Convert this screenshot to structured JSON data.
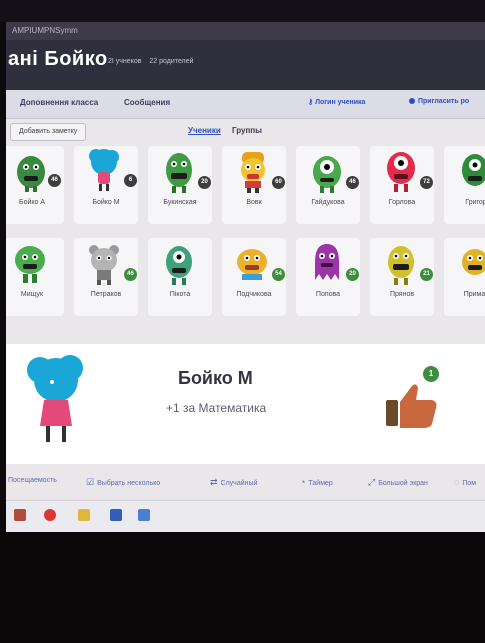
{
  "browser": {
    "tab_title": "AMPIUMPNSymm"
  },
  "header": {
    "class_title": "ані Бойко",
    "students_count": "2I учнеков",
    "parents_count": "22 родителей"
  },
  "subnav": {
    "report_label": "Доповнення класса",
    "messages_label": "Сообщения",
    "student_login_label": "Логин ученика",
    "invite_label": "Пригласить ро"
  },
  "toolbar": {
    "add_note_label": "Добавить заметку",
    "tab_students": "Ученики",
    "tab_groups": "Группы"
  },
  "students_row1": [
    {
      "name": "Бойко А",
      "points": "46",
      "color": "#3a8a3e"
    },
    {
      "name": "Бойко М",
      "points": "6",
      "color": "#1aa7d8"
    },
    {
      "name": "Букинская",
      "points": "20",
      "color": "#3f9c42"
    },
    {
      "name": "Вовк",
      "points": "60",
      "color": "#e6a21a"
    },
    {
      "name": "Гайдукова",
      "points": "46",
      "color": "#49a84a"
    },
    {
      "name": "Горлова",
      "points": "72",
      "color": "#e32c4c"
    },
    {
      "name": "Григор",
      "points": "",
      "color": "#2f8a3a"
    }
  ],
  "students_row2": [
    {
      "name": "Мищук",
      "points": "",
      "color": "#49ad4e"
    },
    {
      "name": "Петраков",
      "points": "46",
      "color": "#8a8a8a"
    },
    {
      "name": "Пікота",
      "points": "",
      "color": "#3da27b"
    },
    {
      "name": "Подчикова",
      "points": "54",
      "color": "#ebb12a"
    },
    {
      "name": "Попова",
      "points": "20",
      "color": "#9b34a6"
    },
    {
      "name": "Прянов",
      "points": "21",
      "color": "#d1c02a"
    },
    {
      "name": "Примак",
      "points": "",
      "color": "#e0b228"
    }
  ],
  "detail": {
    "student_name": "Бойко М",
    "reason": "+1 за Математика",
    "point_badge": "1"
  },
  "actions": {
    "attendance": "Посещаемость",
    "select_multiple": "Выбрать несколько",
    "random": "Случайный",
    "timer": "Таймер",
    "big_screen": "Большой экран",
    "more": "Пом"
  }
}
